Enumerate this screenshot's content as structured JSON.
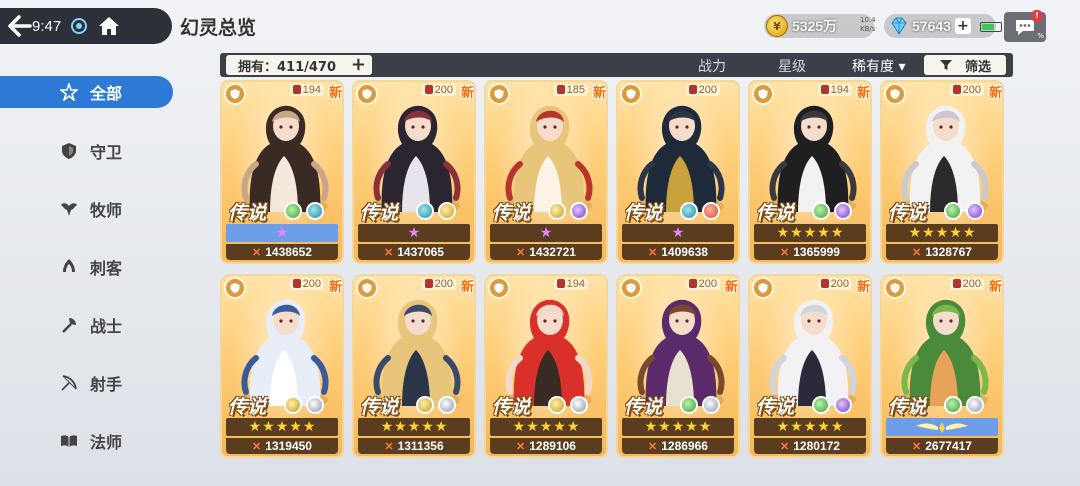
{
  "status": {
    "time": "9:47",
    "net_speed": "10.4\nKB/s",
    "battery": "%"
  },
  "header": {
    "title": "幻灵总览"
  },
  "currency": {
    "gold": "5325万",
    "gem": "57643",
    "gold_icon": "coin-icon",
    "gem_icon": "gem-icon"
  },
  "sidebar": {
    "items": [
      {
        "label": "全部",
        "icon": "star-icon",
        "active": true
      },
      {
        "label": "守卫",
        "icon": "shield-icon",
        "active": false
      },
      {
        "label": "牧师",
        "icon": "wings-icon",
        "active": false
      },
      {
        "label": "刺客",
        "icon": "dagger-icon",
        "active": false
      },
      {
        "label": "战士",
        "icon": "axe-icon",
        "active": false
      },
      {
        "label": "射手",
        "icon": "bow-icon",
        "active": false
      },
      {
        "label": "法师",
        "icon": "book-icon",
        "active": false
      }
    ]
  },
  "filter": {
    "owned": "拥有：411/470",
    "sort_power": "战力",
    "sort_star": "星级",
    "sort_rarity": "稀有度 ▾",
    "filter_label": "筛选"
  },
  "cards": [
    {
      "level": "194",
      "rarity": "传说",
      "power": "1438652",
      "stars_type": "pink",
      "stars": 1,
      "stars_bar": "blue",
      "elems": [
        "green",
        "teal"
      ],
      "new": true,
      "palette": [
        "#3a2a24",
        "#f2e8dc",
        "#c9a58a"
      ]
    },
    {
      "level": "200",
      "rarity": "传说",
      "power": "1437065",
      "stars_type": "pink",
      "stars": 1,
      "stars_bar": "brown",
      "elems": [
        "teal",
        "gold"
      ],
      "new": true,
      "palette": [
        "#2a2530",
        "#e8e4ec",
        "#8a3038"
      ]
    },
    {
      "level": "185",
      "rarity": "传说",
      "power": "1432721",
      "stars_type": "pink",
      "stars": 1,
      "stars_bar": "brown",
      "elems": [
        "gold",
        "purple"
      ],
      "new": true,
      "palette": [
        "#e7c57a",
        "#fbf4e6",
        "#b9342d"
      ]
    },
    {
      "level": "200",
      "rarity": "传说",
      "power": "1409638",
      "stars_type": "pink",
      "stars": 1,
      "stars_bar": "brown",
      "elems": [
        "teal",
        "spiral"
      ],
      "new": false,
      "palette": [
        "#1e2a3a",
        "#c9a23e",
        "#2a3548"
      ]
    },
    {
      "level": "194",
      "rarity": "传说",
      "power": "1365999",
      "stars_type": "gold",
      "stars": 5,
      "stars_bar": "brown",
      "elems": [
        "green",
        "purple"
      ],
      "new": true,
      "palette": [
        "#1f1f22",
        "#f2f2f2",
        "#3a3a3e"
      ]
    },
    {
      "level": "200",
      "rarity": "传说",
      "power": "1328767",
      "stars_type": "gold",
      "stars": 5,
      "stars_bar": "brown",
      "elems": [
        "green",
        "purple"
      ],
      "new": true,
      "palette": [
        "#f2f2f2",
        "#2a2a2e",
        "#c9c9cf"
      ]
    },
    {
      "level": "200",
      "rarity": "传说",
      "power": "1319450",
      "stars_type": "gold",
      "stars": 5,
      "stars_bar": "brown",
      "elems": [
        "gold",
        "silver"
      ],
      "new": true,
      "palette": [
        "#e8eef8",
        "#ffffff",
        "#3a5a9c"
      ]
    },
    {
      "level": "200",
      "rarity": "传说",
      "power": "1311356",
      "stars_type": "gold",
      "stars": 5,
      "stars_bar": "brown",
      "elems": [
        "gold",
        "silver"
      ],
      "new": true,
      "palette": [
        "#e7c57a",
        "#2a3548",
        "#3a4a6a"
      ]
    },
    {
      "level": "194",
      "rarity": "传说",
      "power": "1289106",
      "stars_type": "gold",
      "stars": 5,
      "stars_bar": "brown",
      "elems": [
        "gold",
        "silver"
      ],
      "new": false,
      "palette": [
        "#d9302a",
        "#3a2a24",
        "#f2d9c9"
      ]
    },
    {
      "level": "200",
      "rarity": "传说",
      "power": "1286966",
      "stars_type": "gold",
      "stars": 5,
      "stars_bar": "brown",
      "elems": [
        "green",
        "silver"
      ],
      "new": true,
      "palette": [
        "#5a2a6a",
        "#e8e0d0",
        "#7a4a2a"
      ]
    },
    {
      "level": "200",
      "rarity": "传说",
      "power": "1280172",
      "stars_type": "gold",
      "stars": 5,
      "stars_bar": "brown",
      "elems": [
        "green",
        "purple"
      ],
      "new": true,
      "palette": [
        "#f2f2f5",
        "#2a2a3a",
        "#d0d4dc"
      ]
    },
    {
      "level": "200",
      "rarity": "传说",
      "power": "2677417",
      "stars_type": "wings",
      "stars": 0,
      "stars_bar": "blue",
      "elems": [
        "green",
        "silver"
      ],
      "new": true,
      "palette": [
        "#4a8a3a",
        "#e8a35a",
        "#7ab84a"
      ]
    }
  ],
  "colors": {
    "accent": "#2d79d6",
    "card_gold": "#ffcf7a",
    "bar_dark": "#3b3f47"
  }
}
